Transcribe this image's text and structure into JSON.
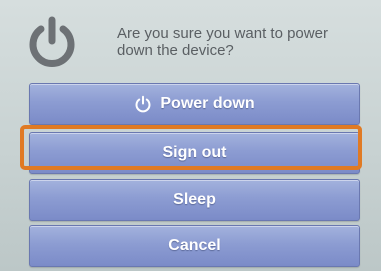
{
  "dialog": {
    "prompt": "Are you sure you want to power down the device?",
    "icon": "power-icon"
  },
  "buttons": {
    "power_down": "Power down",
    "sign_out": "Sign out",
    "sleep": "Sleep",
    "cancel": "Cancel"
  },
  "highlight": {
    "target": "sign-out-button",
    "color": "#e07a24"
  },
  "colors": {
    "button_fill": "#8c9cd2",
    "background": "#c8d2d2",
    "text": "#5a5f63"
  }
}
